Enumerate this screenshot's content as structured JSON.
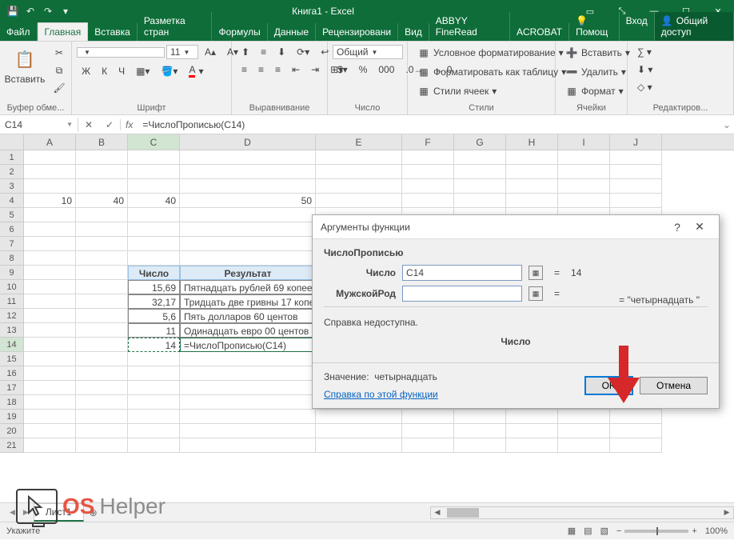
{
  "app": {
    "title": "Книга1 - Excel"
  },
  "qat": [
    "save",
    "undo",
    "redo",
    "touch"
  ],
  "wincontrols": [
    "ribbon-opts",
    "fullscreen",
    "min",
    "max",
    "close"
  ],
  "tabs": {
    "file": "Файл",
    "list": [
      "Главная",
      "Вставка",
      "Разметка стран",
      "Формулы",
      "Данные",
      "Рецензировани",
      "Вид",
      "ABBYY FineRead",
      "ACROBAT"
    ],
    "active": 0,
    "help": "Помощ",
    "signin": "Вход",
    "share": "Общий доступ"
  },
  "ribbon": {
    "clipboard": {
      "paste": "Вставить",
      "label": "Буфер обме..."
    },
    "font": {
      "name": "",
      "size": "11",
      "label": "Шрифт",
      "bold": "Ж",
      "italic": "К",
      "underline": "Ч"
    },
    "align": {
      "label": "Выравнивание"
    },
    "number": {
      "format": "Общий",
      "label": "Число"
    },
    "styles": {
      "condfmt": "Условное форматирование",
      "table": "Форматировать как таблицу",
      "cellstyles": "Стили ячеек",
      "label": "Стили"
    },
    "cells": {
      "insert": "Вставить",
      "delete": "Удалить",
      "format": "Формат",
      "label": "Ячейки"
    },
    "editing": {
      "label": "Редактиров..."
    }
  },
  "formula_bar": {
    "namebox": "C14",
    "formula": "=ЧислоПрописью(C14)"
  },
  "columns": [
    "A",
    "B",
    "C",
    "D",
    "E",
    "F",
    "G",
    "H",
    "I",
    "J"
  ],
  "col_widths_class": [
    "colA",
    "colB",
    "colC",
    "colD",
    "colE",
    "colF",
    "colG",
    "colH",
    "colI",
    "colJ"
  ],
  "sheet": {
    "r4": {
      "A": "10",
      "B": "40",
      "C": "40",
      "D": "50"
    },
    "hdr": {
      "C": "Число",
      "D": "Результат"
    },
    "rows": [
      {
        "num": "15,69",
        "res": "Пятнадцать рублей 69 копеек"
      },
      {
        "num": "32,17",
        "res": "Тридцать две гривны 17 копеек"
      },
      {
        "num": "5,6",
        "res": "Пять долларов 60 центов"
      },
      {
        "num": "11",
        "res": "Одинадцать евро 00 центов"
      },
      {
        "num": "14",
        "res": "=ЧислоПрописью(C14)"
      }
    ]
  },
  "sheet_tab": "Лист1",
  "status": {
    "mode": "Укажите",
    "zoom": "100%"
  },
  "dialog": {
    "title": "Аргументы функции",
    "func": "ЧислоПрописью",
    "args": [
      {
        "label": "Число",
        "value": "C14",
        "result": "14"
      },
      {
        "label": "МужскойРод",
        "value": "",
        "result": ""
      }
    ],
    "result_preview": "\"четырнадцать \"",
    "help_unavailable": "Справка недоступна.",
    "current_arg": "Число",
    "value_label": "Значение:",
    "value": "четырнадцать",
    "help_link": "Справка по этой функции",
    "ok": "OK",
    "cancel": "Отмена"
  },
  "watermark": {
    "os": "OS",
    "helper": "Helper"
  }
}
